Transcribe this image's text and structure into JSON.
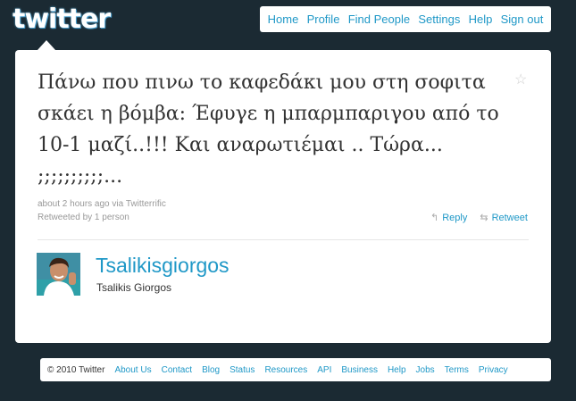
{
  "brand": {
    "logo_text": "twitter"
  },
  "nav": {
    "items": [
      "Home",
      "Profile",
      "Find People",
      "Settings",
      "Help",
      "Sign out"
    ]
  },
  "tweet": {
    "text": "Πάνω που πινω το καφεδάκι μου στη σοφιτα σκάει η βόμβα: Έφυγε η μπαρμπαριγου από το 10-1 μαζί..!!! Και αναρωτιέμαι .. Τώρα... ;;;;;;;;;;...",
    "time": "about 2 hours ago",
    "via_label": "via",
    "source": "Twitterrific",
    "retweeted_by": "Retweeted by 1 person",
    "reply_label": "Reply",
    "retweet_label": "Retweet",
    "favorite_icon": "star-icon"
  },
  "author": {
    "username": "Tsalikisgiorgos",
    "full_name": "Tsalikis Giorgos",
    "avatar": "avatar-image"
  },
  "footer": {
    "copyright": "© 2010 Twitter",
    "links": [
      "About Us",
      "Contact",
      "Blog",
      "Status",
      "Resources",
      "API",
      "Business",
      "Help",
      "Jobs",
      "Terms",
      "Privacy"
    ]
  },
  "colors": {
    "background": "#1b2a33",
    "link": "#1f98c7",
    "text": "#333333",
    "muted": "#999999"
  }
}
